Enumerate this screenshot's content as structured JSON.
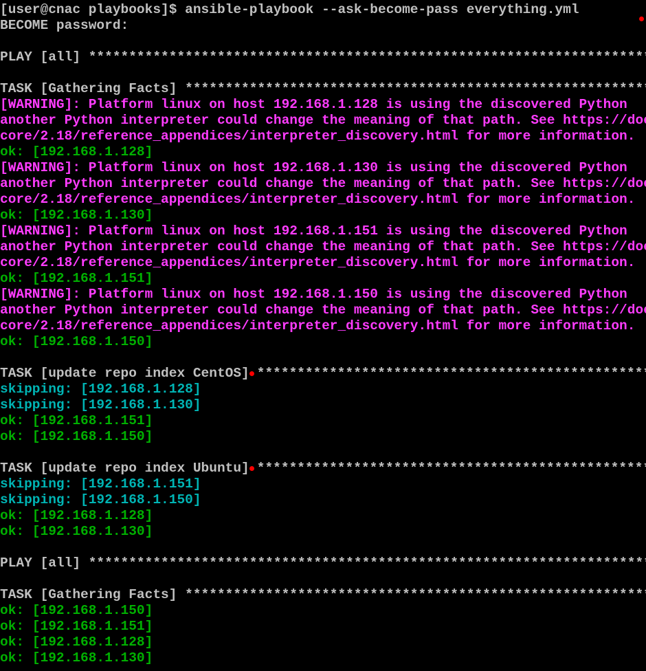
{
  "terminal": {
    "colors": {
      "background": "#000000",
      "default": "#c0c0c0",
      "warning": "#ff3cff",
      "ok": "#00b000",
      "skipping": "#00b4b4",
      "marker": "#ff0000"
    },
    "lines": [
      {
        "text": "[user@cnac playbooks]$ ansible-playbook --ask-become-pass everything.yml",
        "style": "default"
      },
      {
        "text": "BECOME password:",
        "style": "default"
      },
      {
        "text": "",
        "style": "default"
      },
      {
        "text": "PLAY [all] ******************************************************************************",
        "style": "default"
      },
      {
        "text": "",
        "style": "default"
      },
      {
        "text": "TASK [Gathering Facts] ******************************************************************",
        "style": "default"
      },
      {
        "text": "[WARNING]: Platform linux on host 192.168.1.128 is using the discovered Python",
        "style": "warn"
      },
      {
        "text": "another Python interpreter could change the meaning of that path. See https://docs.ansible.com/ansible-",
        "style": "warn"
      },
      {
        "text": "core/2.18/reference_appendices/interpreter_discovery.html for more information.",
        "style": "warn"
      },
      {
        "text": "ok: [192.168.1.128]",
        "style": "ok"
      },
      {
        "text": "[WARNING]: Platform linux on host 192.168.1.130 is using the discovered Python",
        "style": "warn"
      },
      {
        "text": "another Python interpreter could change the meaning of that path. See https://docs.ansible.com/ansible-",
        "style": "warn"
      },
      {
        "text": "core/2.18/reference_appendices/interpreter_discovery.html for more information.",
        "style": "warn"
      },
      {
        "text": "ok: [192.168.1.130]",
        "style": "ok"
      },
      {
        "text": "[WARNING]: Platform linux on host 192.168.1.151 is using the discovered Python",
        "style": "warn"
      },
      {
        "text": "another Python interpreter could change the meaning of that path. See https://docs.ansible.com/ansible-",
        "style": "warn"
      },
      {
        "text": "core/2.18/reference_appendices/interpreter_discovery.html for more information.",
        "style": "warn"
      },
      {
        "text": "ok: [192.168.1.151]",
        "style": "ok"
      },
      {
        "text": "[WARNING]: Platform linux on host 192.168.1.150 is using the discovered Python",
        "style": "warn"
      },
      {
        "text": "another Python interpreter could change the meaning of that path. See https://docs.ansible.com/ansible-",
        "style": "warn"
      },
      {
        "text": "core/2.18/reference_appendices/interpreter_discovery.html for more information.",
        "style": "warn"
      },
      {
        "text": "ok: [192.168.1.150]",
        "style": "ok"
      },
      {
        "text": "",
        "style": "default"
      },
      {
        "text": "TASK [update repo index CentOS]",
        "style": "default",
        "marker": true,
        "suffix": "*********************************************************"
      },
      {
        "text": "skipping: [192.168.1.128]",
        "style": "skip"
      },
      {
        "text": "skipping: [192.168.1.130]",
        "style": "skip"
      },
      {
        "text": "ok: [192.168.1.151]",
        "style": "ok"
      },
      {
        "text": "ok: [192.168.1.150]",
        "style": "ok"
      },
      {
        "text": "",
        "style": "default"
      },
      {
        "text": "TASK [update repo index Ubuntu]",
        "style": "default",
        "marker": true,
        "suffix": "*********************************************************"
      },
      {
        "text": "skipping: [192.168.1.151]",
        "style": "skip"
      },
      {
        "text": "skipping: [192.168.1.150]",
        "style": "skip"
      },
      {
        "text": "ok: [192.168.1.128]",
        "style": "ok"
      },
      {
        "text": "ok: [192.168.1.130]",
        "style": "ok"
      },
      {
        "text": "",
        "style": "default"
      },
      {
        "text": "PLAY [all] ******************************************************************************",
        "style": "default"
      },
      {
        "text": "",
        "style": "default"
      },
      {
        "text": "TASK [Gathering Facts] ******************************************************************",
        "style": "default"
      },
      {
        "text": "ok: [192.168.1.150]",
        "style": "ok"
      },
      {
        "text": "ok: [192.168.1.151]",
        "style": "ok"
      },
      {
        "text": "ok: [192.168.1.128]",
        "style": "ok"
      },
      {
        "text": "ok: [192.168.1.130]",
        "style": "ok"
      }
    ]
  }
}
